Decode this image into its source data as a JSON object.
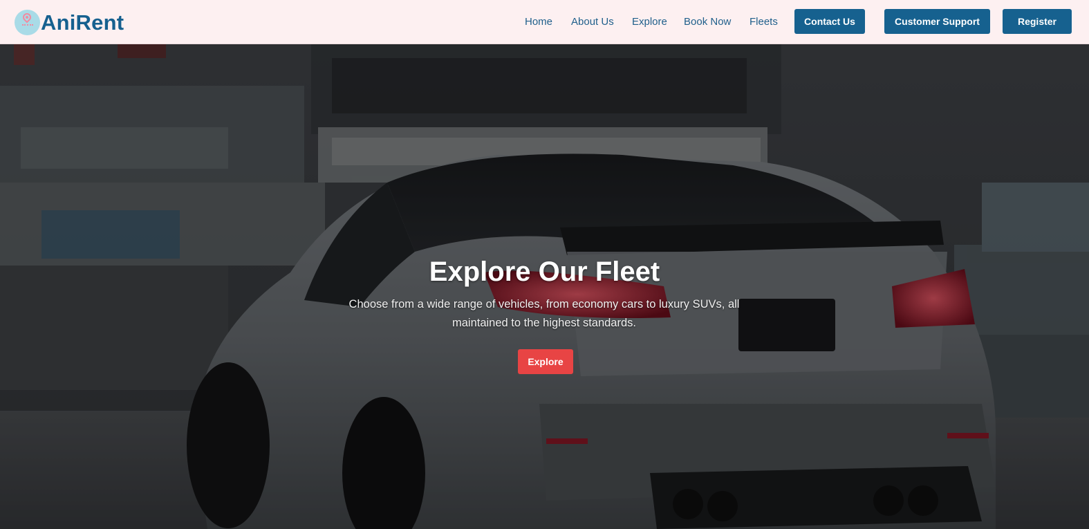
{
  "brand": {
    "name": "AniRent",
    "logo_icon": "map-pin-icon"
  },
  "nav": {
    "links": [
      "Home",
      "About Us",
      "Explore",
      "Book Now",
      "Fleets"
    ],
    "buttons": [
      "Contact Us",
      "Customer Support",
      "Register"
    ]
  },
  "hero": {
    "title": "Explore Our Fleet",
    "subtitle": "Choose from a wide range of vehicles, from economy cars to luxury SUVs, all maintained to the highest standards.",
    "button_label": "Explore"
  },
  "colors": {
    "nav_bg": "#fdf0f1",
    "brand": "#16608f",
    "nav_button": "#16618f",
    "hero_button": "#e84444"
  }
}
